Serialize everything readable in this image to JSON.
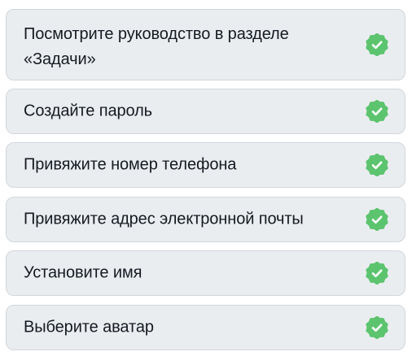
{
  "tasks": [
    {
      "label": "Посмотрите руководство в разделе «Задачи»",
      "status": "completed",
      "icon": "check-badge-icon"
    },
    {
      "label": "Создайте пароль",
      "status": "completed",
      "icon": "check-badge-icon"
    },
    {
      "label": "Привяжите номер телефона",
      "status": "completed",
      "icon": "check-badge-icon"
    },
    {
      "label": "Привяжите адрес электронной почты",
      "status": "completed",
      "icon": "check-badge-icon"
    },
    {
      "label": "Установите имя",
      "status": "completed",
      "icon": "check-badge-icon"
    },
    {
      "label": "Выберите аватар",
      "status": "completed",
      "icon": "check-badge-icon"
    }
  ],
  "colors": {
    "card_background": "#eaedf0",
    "card_border": "#d2d6db",
    "text": "#151a21",
    "badge_green": "#5cc46e",
    "check_mark": "#ffffff"
  }
}
